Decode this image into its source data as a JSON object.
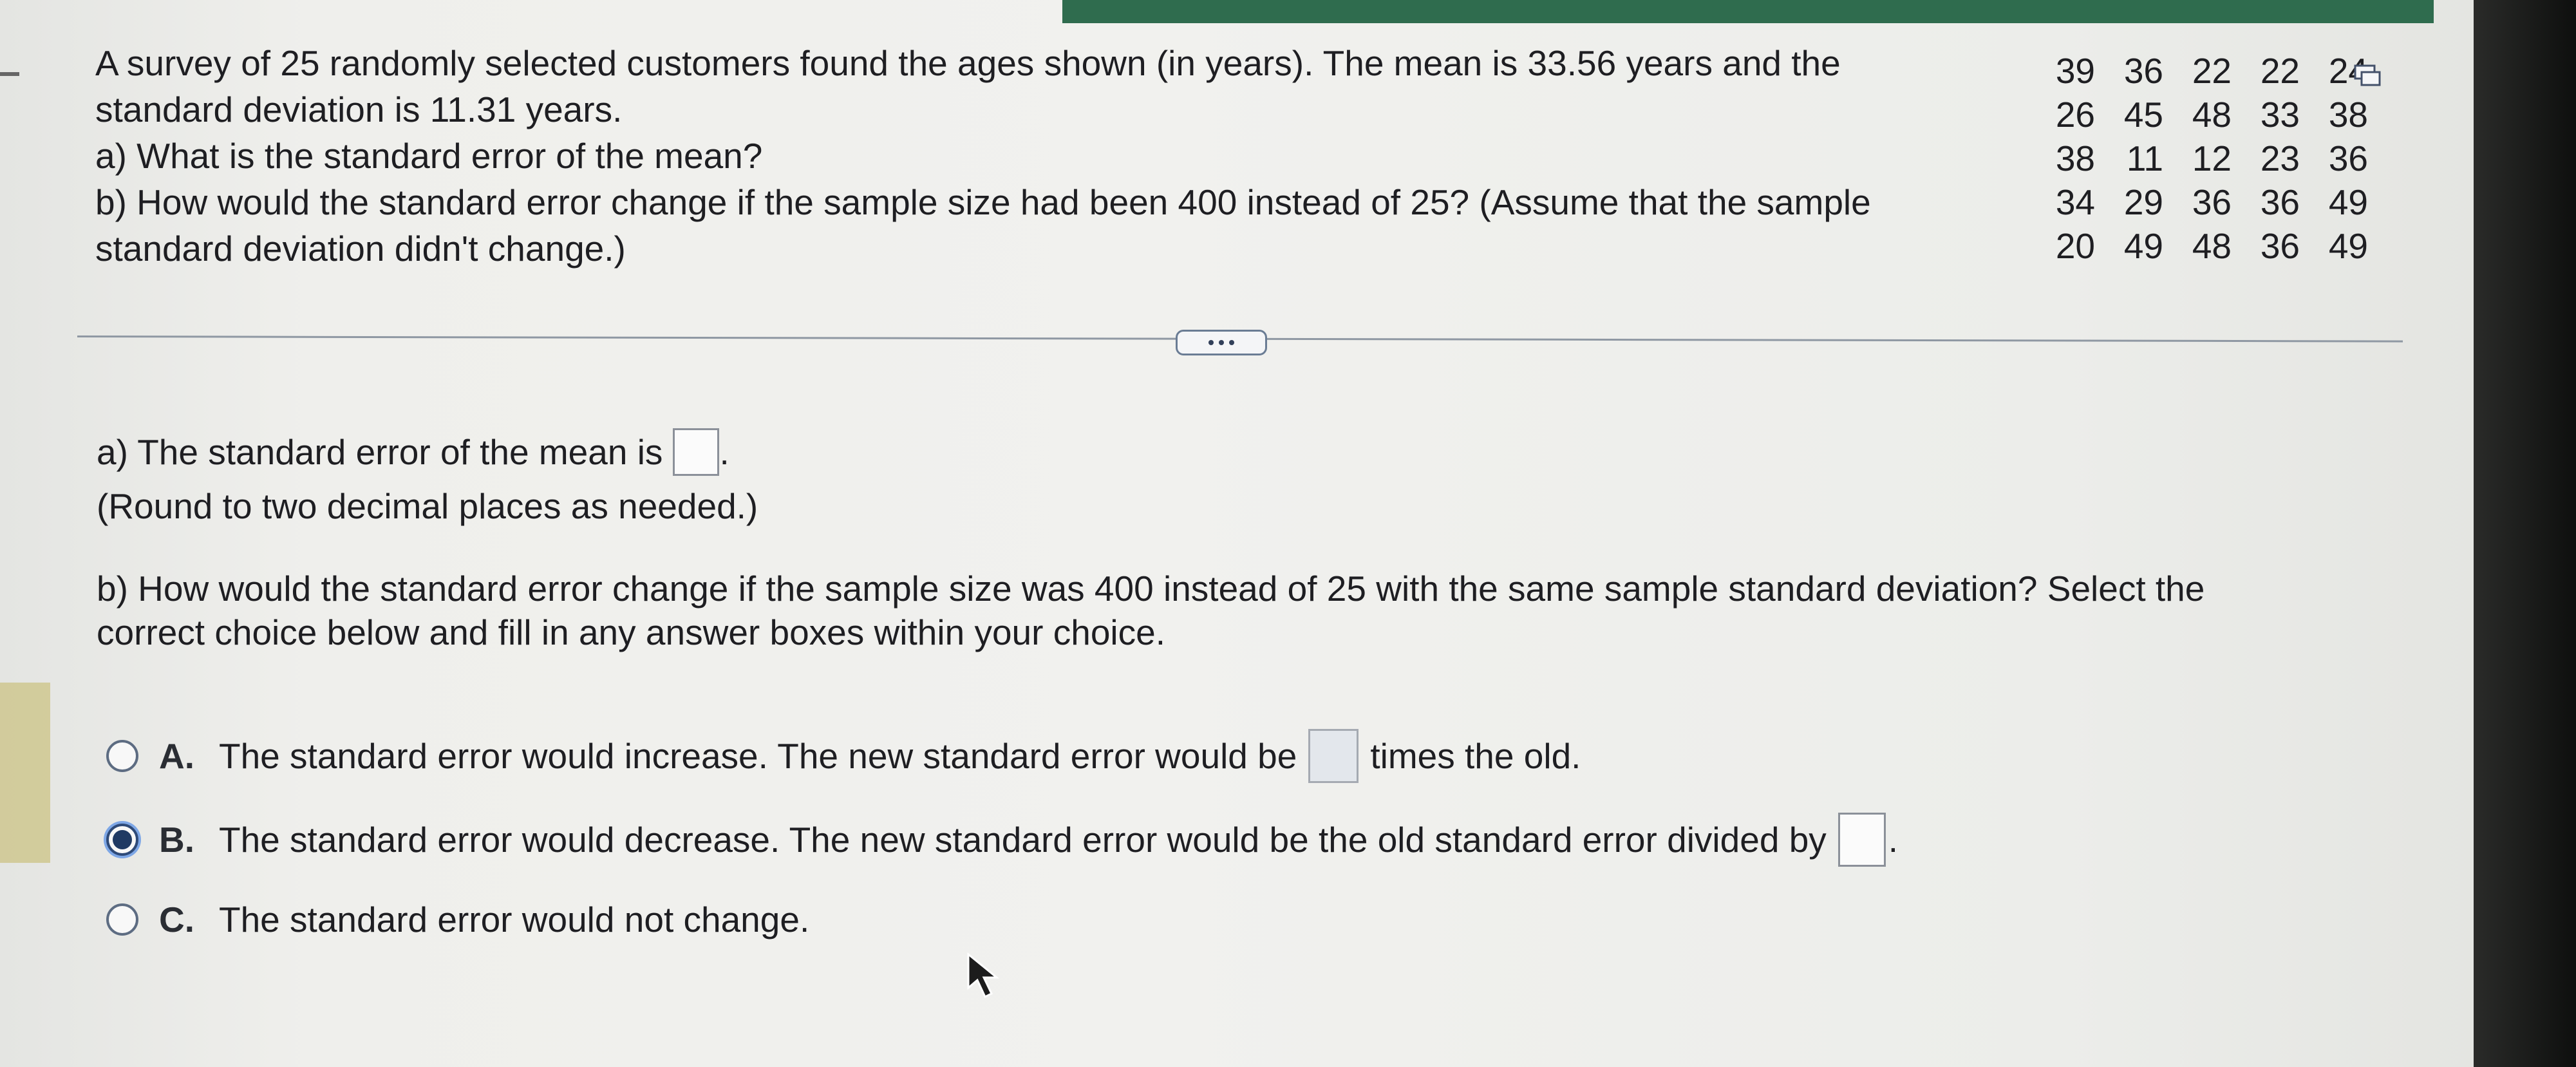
{
  "question": {
    "line1": "A survey of 25 randomly selected customers found the ages shown (in years). The mean is 33.56 years and the",
    "line2": "standard deviation is 11.31 years.",
    "line3": "a) What is the standard error of the mean?",
    "line4": "b) How would the standard error change if the sample size had been 400 instead of 25? (Assume that the sample",
    "line5": "standard deviation didn't change.)"
  },
  "data_table": {
    "rows": [
      [
        "39",
        "36",
        "22",
        "22",
        "24"
      ],
      [
        "26",
        "45",
        "48",
        "33",
        "38"
      ],
      [
        "38",
        "11",
        "12",
        "23",
        "36"
      ],
      [
        "34",
        "29",
        "36",
        "36",
        "49"
      ],
      [
        "20",
        "49",
        "48",
        "36",
        "49"
      ]
    ]
  },
  "part_a": {
    "prefix": "a) The standard error of the mean is",
    "suffix": ".",
    "answer_value": "",
    "note": "(Round to two decimal places as needed.)"
  },
  "part_b": {
    "line1": "b) How would the standard error change if the sample size was 400 instead of 25 with the same sample standard deviation? Select the",
    "line2": "correct choice below and fill in any answer boxes within your choice."
  },
  "options": [
    {
      "letter": "A.",
      "text_before": "The standard error would increase. The new standard error would be",
      "text_after": "times the old.",
      "selected": false
    },
    {
      "letter": "B.",
      "text_before": "The standard error would decrease. The new standard error would be the old standard error divided by",
      "text_after": ".",
      "selected": true
    },
    {
      "letter": "C.",
      "text_before": "The standard error would not change.",
      "text_after": "",
      "selected": false
    }
  ],
  "colors": {
    "accent_green": "#2f6c4e",
    "radio_selected": "#203a63"
  }
}
